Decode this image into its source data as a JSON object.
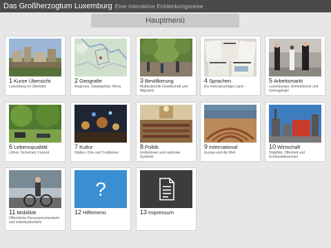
{
  "header": {
    "title": "Das Großherzogtum Luxemburg",
    "subtitle": "Eine interaktive Entdeckungsreise"
  },
  "menu": {
    "title": "Hauptmenü"
  },
  "tiles": [
    {
      "num": "1",
      "title": "Kurze Übersicht",
      "subtitle": "Luxemburg im Überblick",
      "icon": "city-panorama-photo"
    },
    {
      "num": "2",
      "title": "Geografie",
      "subtitle": "Regionen, Staatsgebiet, Klima",
      "icon": "map-photo"
    },
    {
      "num": "3",
      "title": "Bevölkerung",
      "subtitle": "Multikulturelle Gesellschaft und Migration",
      "icon": "square-people-photo"
    },
    {
      "num": "4",
      "title": "Sprachen",
      "subtitle": "Ein mehrsprachiges Land",
      "icon": "newspapers-photo"
    },
    {
      "num": "5",
      "title": "Arbeitsmarkt",
      "subtitle": "Luxemburger, Einheimische und Grenzgänger",
      "icon": "walking-people-photo"
    },
    {
      "num": "6",
      "title": "Lebensqualität",
      "subtitle": "Löhne, Sicherheit, Freizeit",
      "icon": "park-photo"
    },
    {
      "num": "7",
      "title": "Kultur",
      "subtitle": "Stätten, Orte und Traditionen",
      "icon": "night-lights-photo"
    },
    {
      "num": "8",
      "title": "Politik",
      "subtitle": "Institutionen und nationale Symbole",
      "icon": "parliament-photo"
    },
    {
      "num": "9",
      "title": "International",
      "subtitle": "Europa und die Welt",
      "icon": "hemicycle-photo"
    },
    {
      "num": "10",
      "title": "Wirtschaft",
      "subtitle": "Stabilität, Offenheit und Schlüsselbranchen",
      "icon": "industrial-photo"
    },
    {
      "num": "11",
      "title": "Mobilität",
      "subtitle": "Öffentlicher Personennahverkehr und Individualverkehr",
      "icon": "cyclist-photo"
    },
    {
      "num": "12",
      "title": "Hilfemenü",
      "subtitle": "",
      "icon": "question-icon"
    },
    {
      "num": "13",
      "title": "Impressum",
      "subtitle": "",
      "icon": "document-icon"
    }
  ]
}
